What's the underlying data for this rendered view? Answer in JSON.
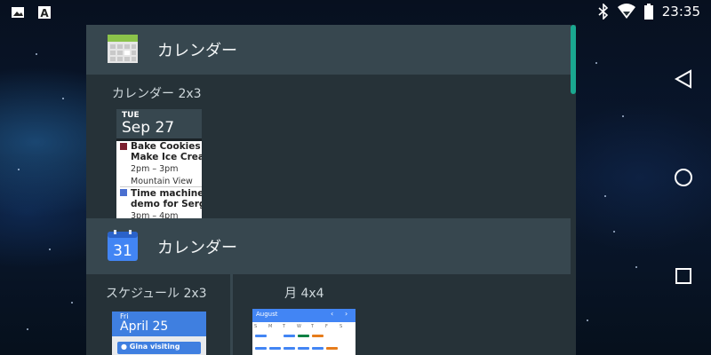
{
  "status_bar": {
    "time": "23:35",
    "left_icons": [
      "image-icon",
      "font-a-icon"
    ],
    "right_icons": [
      "bluetooth-icon",
      "wifi-icon",
      "battery-icon"
    ]
  },
  "nav_bar": {
    "icons": [
      "back-icon",
      "home-icon",
      "recents-icon"
    ]
  },
  "colors": {
    "panel_bg": "#263238",
    "header_bg": "#37474f",
    "scroll_accent": "#1aa890",
    "google_blue": "#4285f4"
  },
  "apps": [
    {
      "name": "カレンダー",
      "icon": "calendar-grid-icon",
      "widgets": [
        {
          "label": "カレンダー 2x3",
          "preview": {
            "day": "TUE",
            "date": "Sep 27",
            "events": [
              {
                "title_line1": "Bake Cookies &",
                "title_line2": "Make Ice Cream",
                "time": "2pm – 3pm",
                "location": "Mountain View",
                "color": "#7b1f2f"
              },
              {
                "title_line1": "Time machine",
                "title_line2": "demo for Sergey",
                "time": "3pm – 4pm",
                "color": "#4a6fd0"
              }
            ]
          }
        }
      ]
    },
    {
      "name": "カレンダー",
      "icon": "calendar-31-icon",
      "icon_text": "31",
      "widgets": [
        {
          "label": "スケジュール 2x3",
          "preview": {
            "day": "Fri",
            "date": "April 25",
            "event": "Gina visiting"
          }
        },
        {
          "label": "月 4x4",
          "preview": {
            "month": "August",
            "prev": "‹",
            "next": "›",
            "weekdays": [
              "S",
              "M",
              "T",
              "W",
              "T",
              "F",
              "S"
            ]
          }
        }
      ]
    }
  ]
}
